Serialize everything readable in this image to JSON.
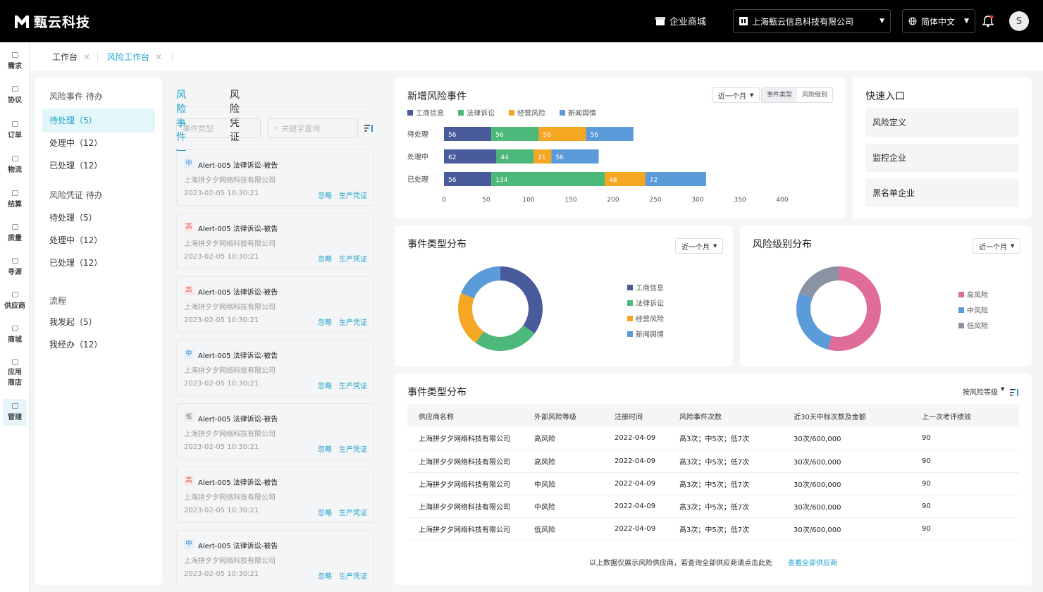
{
  "header": {
    "brand": "甄云科技",
    "mall": "企业商城",
    "company": "上海甄云信息科技有限公司",
    "language": "简体中文",
    "avatar": "S"
  },
  "sidebar": {
    "items": [
      {
        "label": "需求"
      },
      {
        "label": "协议"
      },
      {
        "label": "订单"
      },
      {
        "label": "物流"
      },
      {
        "label": "结算"
      },
      {
        "label": "质量"
      },
      {
        "label": "寻源"
      },
      {
        "label": "供应商"
      },
      {
        "label": "商城"
      },
      {
        "label": "应用商店"
      },
      {
        "label": "管理"
      }
    ]
  },
  "tabs": [
    {
      "label": "工作台"
    },
    {
      "label": "风险工作台"
    }
  ],
  "leftnav": {
    "sec1": "风险事件 待办",
    "sec1_items": [
      {
        "label": "待处理（5）"
      },
      {
        "label": "处理中（12）"
      },
      {
        "label": "已处理（12）"
      }
    ],
    "sec2": "风险凭证 待办",
    "sec2_items": [
      {
        "label": "待处理（5）"
      },
      {
        "label": "处理中（12）"
      },
      {
        "label": "已处理（12）"
      }
    ],
    "sec3": "流程",
    "sec3_items": [
      {
        "label": "我发起（5）"
      },
      {
        "label": "我经办（12）"
      }
    ]
  },
  "events": {
    "tab_events": "风险事件",
    "tab_vouchers": "风险凭证",
    "type_placeholder": "事件类型",
    "search_placeholder": "关键字查询",
    "cards": [
      {
        "level": "中",
        "title": "Alert-005 法律诉讼-被告",
        "company": "上海拼夕夕网络科技有限公司",
        "time": "2023-02-05  10:30:21",
        "ignore": "忽略",
        "generate": "生产凭证"
      },
      {
        "level": "高",
        "title": "Alert-005 法律诉讼-被告",
        "company": "上海拼夕夕网络科技有限公司",
        "time": "2023-02-05  10:30:21",
        "ignore": "忽略",
        "generate": "生产凭证"
      },
      {
        "level": "高",
        "title": "Alert-005 法律诉讼-被告",
        "company": "上海拼夕夕网络科技有限公司",
        "time": "2023-02-05  10:30:21",
        "ignore": "忽略",
        "generate": "生产凭证"
      },
      {
        "level": "中",
        "title": "Alert-005 法律诉讼-被告",
        "company": "上海拼夕夕网络科技有限公司",
        "time": "2023-02-05  10:30:21",
        "ignore": "忽略",
        "generate": "生产凭证"
      },
      {
        "level": "低",
        "title": "Alert-005 法律诉讼-被告",
        "company": "上海拼夕夕网络科技有限公司",
        "time": "2023-02-05  10:30:21",
        "ignore": "忽略",
        "generate": "生产凭证"
      },
      {
        "level": "高",
        "title": "Alert-005 法律诉讼-被告",
        "company": "上海拼夕夕网络科技有限公司",
        "time": "2023-02-05  10:30:21",
        "ignore": "忽略",
        "generate": "生产凭证"
      },
      {
        "level": "中",
        "title": "Alert-005 法律诉讼-被告",
        "company": "上海拼夕夕网络科技有限公司",
        "time": "2023-02-05  10:30:21",
        "ignore": "忽略",
        "generate": "生产凭证"
      }
    ]
  },
  "colors": {
    "blue_dark": "#4a5b9b",
    "green": "#4cb87a",
    "orange": "#f5a623",
    "blue": "#5b9bd9",
    "pink": "#e06c9a",
    "gray": "#8a93a3",
    "accent": "#1aa3c8"
  },
  "new_events": {
    "title": "新增风险事件",
    "period": "近一个月",
    "seg1": "事件类型",
    "seg2": "风险级别"
  },
  "type_dist": {
    "title": "事件类型分布",
    "period": "近一个月"
  },
  "level_dist": {
    "title": "风险级别分布",
    "period": "近一个月"
  },
  "quick": {
    "title": "快速入口",
    "items": [
      {
        "label": "风险定义"
      },
      {
        "label": "监控企业"
      },
      {
        "label": "黑名单企业"
      }
    ]
  },
  "table": {
    "title": "事件类型分布",
    "sort": "按风险等级",
    "headers": [
      "供应商名称",
      "外部风险等级",
      "注册时间",
      "风险事件次数",
      "近30天中标次数及金额",
      "上一次考评绩效"
    ],
    "rows": [
      [
        "上海拼夕夕网络科技有限公司",
        "高风险",
        "2022-04-09",
        "高3次；中5次；低7次",
        "30次/600,000",
        "90"
      ],
      [
        "上海拼夕夕网络科技有限公司",
        "高风险",
        "2022-04-09",
        "高3次；中5次；低7次",
        "30次/600,000",
        "90"
      ],
      [
        "上海拼夕夕网络科技有限公司",
        "中风险",
        "2022-04-09",
        "高3次；中5次；低7次",
        "30次/600,000",
        "90"
      ],
      [
        "上海拼夕夕网络科技有限公司",
        "中风险",
        "2022-04-09",
        "高3次；中5次；低7次",
        "30次/600,000",
        "90"
      ],
      [
        "上海拼夕夕网络科技有限公司",
        "低风险",
        "2022-04-09",
        "高3次；中5次；低7次",
        "30次/600,000",
        "90"
      ]
    ],
    "note": "以上数据仅展示风险供应商，若查询全部供应商请点击此处",
    "link": "查看全部供应商"
  },
  "chart_data": [
    {
      "type": "bar",
      "orientation": "horizontal",
      "stacked": true,
      "title": "新增风险事件",
      "categories": [
        "待处理",
        "处理中",
        "已处理"
      ],
      "series": [
        {
          "name": "工商信息",
          "values": [
            56,
            62,
            56
          ]
        },
        {
          "name": "法律诉讼",
          "values": [
            56,
            44,
            134
          ]
        },
        {
          "name": "经营风险",
          "values": [
            56,
            21,
            48
          ]
        },
        {
          "name": "新闻舆情",
          "values": [
            56,
            56,
            72
          ]
        }
      ],
      "xlim": [
        0,
        400
      ],
      "xticks": [
        0,
        50,
        100,
        150,
        200,
        250,
        300,
        350,
        400
      ],
      "legend": "top-left"
    },
    {
      "type": "pie",
      "donut": true,
      "title": "事件类型分布",
      "labels": [
        "工商信息",
        "法律诉讼",
        "经营风险",
        "新闻舆情"
      ],
      "values": [
        35,
        25,
        21,
        19
      ],
      "legend": "right"
    },
    {
      "type": "pie",
      "donut": true,
      "title": "风险级别分布",
      "labels": [
        "高风险",
        "中风险",
        "低风险"
      ],
      "values": [
        54,
        27,
        19
      ],
      "legend": "right"
    }
  ]
}
